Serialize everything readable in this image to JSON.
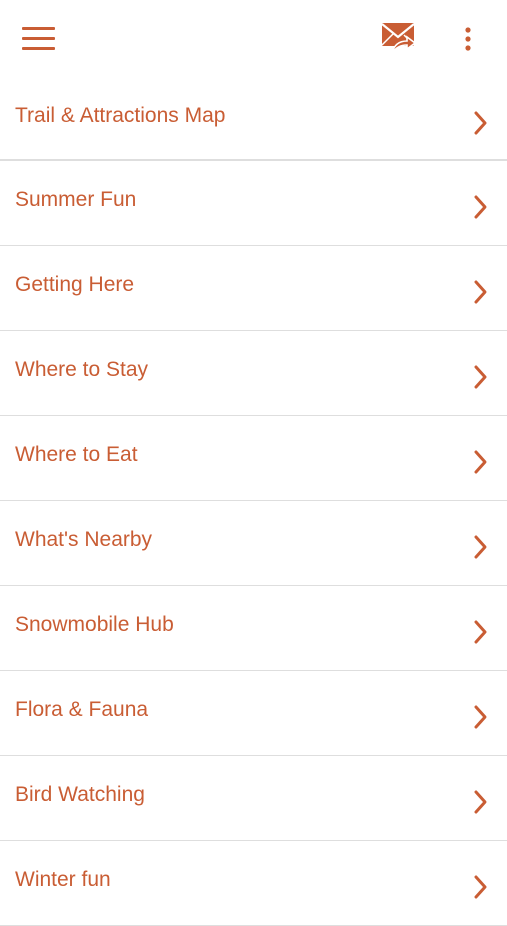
{
  "toolbar": {
    "menu_icon": "hamburger-menu-icon",
    "mail_icon": "envelope-forward-icon",
    "more_icon": "more-vertical-icon"
  },
  "colors": {
    "accent": "#c95d34",
    "divider": "#dedede",
    "background": "#ffffff"
  },
  "menu": {
    "items": [
      {
        "label": "Trail & Attractions Map",
        "icon": "chevron-right-icon"
      },
      {
        "label": "Summer Fun",
        "icon": "chevron-right-icon"
      },
      {
        "label": "Getting Here",
        "icon": "chevron-right-icon"
      },
      {
        "label": "Where to Stay",
        "icon": "chevron-right-icon"
      },
      {
        "label": "Where to Eat",
        "icon": "chevron-right-icon"
      },
      {
        "label": "What's Nearby",
        "icon": "chevron-right-icon"
      },
      {
        "label": "Snowmobile Hub",
        "icon": "chevron-right-icon"
      },
      {
        "label": "Flora & Fauna",
        "icon": "chevron-right-icon"
      },
      {
        "label": "Bird Watching",
        "icon": "chevron-right-icon"
      },
      {
        "label": "Winter fun",
        "icon": "chevron-right-icon"
      }
    ]
  }
}
